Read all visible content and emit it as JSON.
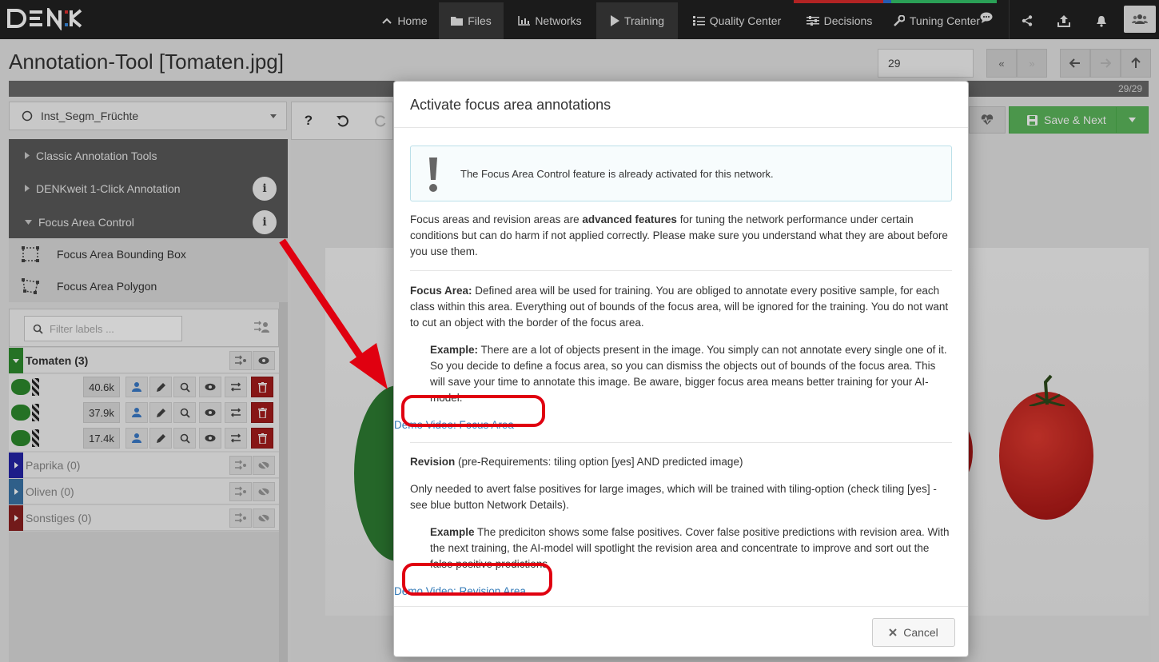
{
  "app": {
    "logo": "DENK"
  },
  "nav": {
    "home": "Home",
    "files": "Files",
    "networks": "Networks",
    "training": "Training",
    "quality": "Quality Center",
    "decisions": "Decisions",
    "tuning": "Tuning Center"
  },
  "page": {
    "title": "Annotation-Tool [Tomaten.jpg]",
    "image_index": "29",
    "progress_label": "29/29",
    "progress": 1.0
  },
  "sidebar": {
    "dropdown_value": "Inst_Segm_Früchte",
    "sections": [
      {
        "label": "Classic Annotation Tools",
        "expanded": false
      },
      {
        "label": "DENKweit 1-Click Annotation",
        "expanded": false
      },
      {
        "label": "Focus Area Control",
        "expanded": true
      }
    ],
    "focus_tools": [
      {
        "label": "Focus Area Bounding Box"
      },
      {
        "label": "Focus Area Polygon"
      }
    ],
    "filter_placeholder": "Filter labels ...",
    "classes": [
      {
        "name": "Tomaten (3)",
        "color": "#2e8b2e"
      },
      {
        "name": "Paprika (0)",
        "color": "#2424a8"
      },
      {
        "name": "Oliven (0)",
        "color": "#3a74a8"
      },
      {
        "name": "Sonstiges (0)",
        "color": "#8c2020"
      }
    ],
    "instances": [
      {
        "size": "40.6k"
      },
      {
        "size": "37.9k"
      },
      {
        "size": "17.4k"
      }
    ]
  },
  "toolbar": {
    "save_label": "Save & Next"
  },
  "modal": {
    "title": "Activate focus area annotations",
    "alert": "The Focus Area Control feature is already activated for this network.",
    "intro_pre": "Focus areas and revision areas are ",
    "intro_bold": "advanced features",
    "intro_post": " for tuning the network performance under certain conditions but can do harm if not applied correctly. Please make sure you understand what they are about before you use them.",
    "focus_label": "Focus Area:",
    "focus_text": " Defined area will be used for training. You are obliged to annotate every positive sample, for each class within this area. Everything out of bounds of the focus area, will be ignored for the training. You do not want to cut an object with the border of the focus area.",
    "focus_example_label": "Example:",
    "focus_example_text": " There are a lot of objects present in the image. You simply can not annotate every single one of it. So you decide to define a focus area, so you can dismiss the objects out of bounds of the focus area. This will save your time to annotate this image. Be aware, bigger focus area means better training for your AI-model.",
    "focus_link": "Demo Video: Focus Area",
    "revision_label": "Revision",
    "revision_text": " (pre-Requirements: tiling option [yes] AND predicted image)",
    "revision_para": "Only needed to avert false positives for large images, which will be trained with tiling-option (check tiling [yes] - see blue button Network Details).",
    "revision_example_label": "Example",
    "revision_example_text": " The prediciton shows some false positives. Cover false positive predictions with revision area. With the next training, the AI-model will spotlight the revision area and concentrate to improve and sort out the false positive predictions.",
    "revision_link": "Demo Video: Revision Area",
    "cancel": "Cancel"
  },
  "colors": {
    "accent": "#337ab7",
    "success": "#5cb85c",
    "annotation_red": "#e00010"
  }
}
